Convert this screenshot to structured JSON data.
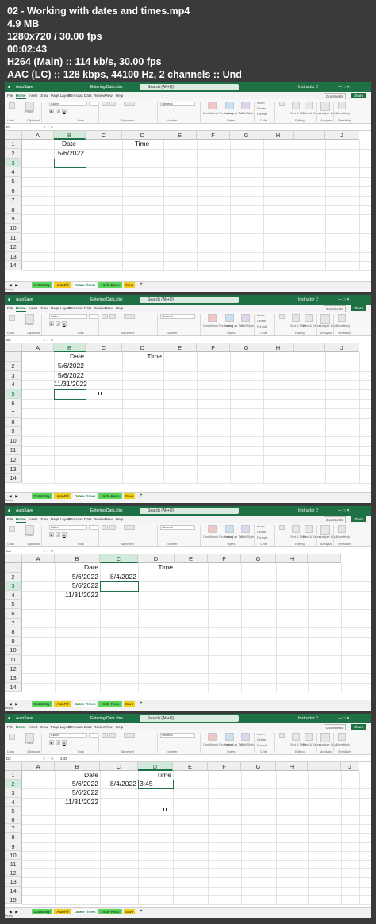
{
  "video_info": {
    "lines": [
      "02 - Working with dates and times.mp4",
      "4.9 MB",
      "1280x720 / 30.00 fps",
      "00:02:43",
      "H264 (Main) :: 114 kb/s, 30.00 fps",
      "AAC (LC) :: 128 kbps, 44100 Hz, 2 channels :: Und"
    ]
  },
  "app": {
    "autosave": "AutoSave",
    "doc_title": "Entering Data.xlsx",
    "search_placeholder": "Search (Alt+Q)",
    "user": "Instructor 2",
    "share": "Share",
    "comments": "Comments",
    "accent": "#1e7145"
  },
  "menu": [
    "File",
    "Home",
    "Insert",
    "Draw",
    "Page Layout",
    "Formulas",
    "Data",
    "Review",
    "View",
    "Help"
  ],
  "ribbon": {
    "groups": [
      "Undo",
      "Clipboard",
      "Font",
      "Alignment",
      "Number",
      "Styles",
      "Cells",
      "Editing",
      "Analysis",
      "Sensitivity"
    ],
    "paste": "Paste",
    "font_name": "Calibri",
    "number_format": "General",
    "conditional": "Conditional Formatting",
    "format_table": "Format as Table",
    "cell_styles": "Cell Styles",
    "insert": "Insert",
    "delete": "Delete",
    "format": "Format",
    "sort_filter": "Sort & Filter",
    "find_select": "Find & Select",
    "analyze": "Analyze Data",
    "sensitivity": "Sensitivity"
  },
  "sheet_tabs": [
    "DataEntry",
    "AutoFill",
    "Dates-Times",
    "Undo-Redo",
    "Save"
  ],
  "tab_colors": [
    "#5bd65b",
    "#f4cc1c",
    "#ffffff",
    "#5bd65b",
    "#f4cc1c"
  ],
  "status": "Ready",
  "frames": [
    {
      "namebox": "B3",
      "formula": "",
      "columns": [
        "A",
        "B",
        "C",
        "D",
        "E",
        "F",
        "G",
        "H",
        "I",
        "J"
      ],
      "rows": [
        "1",
        "2",
        "3",
        "4",
        "5",
        "6",
        "7",
        "8",
        "9",
        "10",
        "11",
        "12",
        "13",
        "14"
      ],
      "cells": [
        {
          "row": 0,
          "col": 1,
          "align": "c",
          "text": "Date"
        },
        {
          "row": 0,
          "col": 3,
          "align": "c",
          "text": "Time"
        },
        {
          "row": 1,
          "col": 1,
          "align": "r",
          "text": "5/6/2022"
        }
      ]
    },
    {
      "namebox": "B5",
      "formula": "",
      "columns": [
        "A",
        "B",
        "C",
        "D",
        "E",
        "F",
        "G",
        "H",
        "I",
        "J"
      ],
      "rows": [
        "1",
        "2",
        "3",
        "4",
        "5",
        "6",
        "7",
        "8",
        "9",
        "10",
        "11",
        "12",
        "13",
        "14"
      ],
      "cells": [
        {
          "row": 0,
          "col": 1,
          "align": "r",
          "text": "Date"
        },
        {
          "row": 0,
          "col": 3,
          "align": "r",
          "text": "Time"
        },
        {
          "row": 1,
          "col": 1,
          "align": "r",
          "text": "5/6/2022"
        },
        {
          "row": 2,
          "col": 1,
          "align": "r",
          "text": "5/6/2022"
        },
        {
          "row": 3,
          "col": 1,
          "align": "r",
          "text": "11/31/2022"
        }
      ]
    },
    {
      "namebox": "C3",
      "formula": "",
      "columns": [
        "A",
        "B",
        "C",
        "D",
        "E",
        "F",
        "G",
        "H",
        "I"
      ],
      "rows": [
        "1",
        "2",
        "3",
        "4",
        "5",
        "6",
        "7",
        "8",
        "9",
        "10",
        "11",
        "12",
        "13",
        "14"
      ],
      "cells": [
        {
          "row": 0,
          "col": 1,
          "align": "r",
          "text": "Date"
        },
        {
          "row": 0,
          "col": 3,
          "align": "r",
          "text": "Time"
        },
        {
          "row": 1,
          "col": 1,
          "align": "r",
          "text": "5/6/2022"
        },
        {
          "row": 1,
          "col": 2,
          "align": "r",
          "text": "8/4/2022"
        },
        {
          "row": 2,
          "col": 1,
          "align": "r",
          "text": "5/6/2022"
        },
        {
          "row": 3,
          "col": 1,
          "align": "r",
          "text": "11/31/2022"
        }
      ]
    },
    {
      "namebox": "D2",
      "formula": "3:45",
      "columns": [
        "A",
        "B",
        "C",
        "D",
        "E",
        "F",
        "G",
        "H",
        "I",
        "J"
      ],
      "rows": [
        "1",
        "2",
        "3",
        "4",
        "5",
        "6",
        "7",
        "8",
        "9",
        "10",
        "11",
        "12",
        "13",
        "14",
        "15"
      ],
      "cells": [
        {
          "row": 0,
          "col": 1,
          "align": "r",
          "text": "Date"
        },
        {
          "row": 0,
          "col": 3,
          "align": "r",
          "text": "Time"
        },
        {
          "row": 1,
          "col": 1,
          "align": "r",
          "text": "5/6/2022"
        },
        {
          "row": 1,
          "col": 2,
          "align": "r",
          "text": "8/4/2022"
        },
        {
          "row": 1,
          "col": 3,
          "align": "l",
          "text": "3:45"
        },
        {
          "row": 2,
          "col": 1,
          "align": "r",
          "text": "5/6/2022"
        },
        {
          "row": 3,
          "col": 1,
          "align": "r",
          "text": "11/31/2022"
        }
      ]
    }
  ]
}
